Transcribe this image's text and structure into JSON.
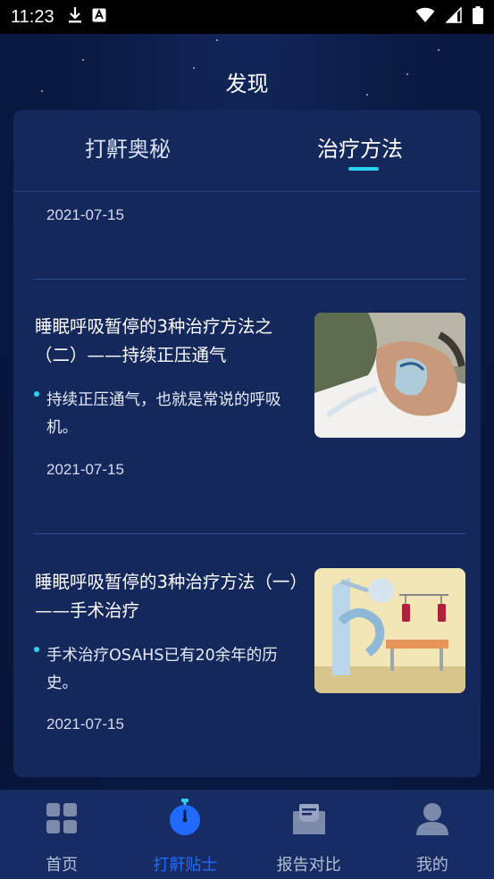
{
  "status_bar": {
    "time": "11:23"
  },
  "page": {
    "title": "发现"
  },
  "tabs": [
    {
      "label": "打鼾奥秘",
      "active": false
    },
    {
      "label": "治疗方法",
      "active": true
    }
  ],
  "articles": [
    {
      "date": "2021-07-15"
    },
    {
      "title": "睡眠呼吸暂停的3种治疗方法之（二）——持续正压通气",
      "desc": "持续正压通气，也就是常说的呼吸机。",
      "date": "2021-07-15"
    },
    {
      "title": "睡眠呼吸暂停的3种治疗方法（一）——手术治疗",
      "desc": "手术治疗OSAHS已有20余年的历史。",
      "date": "2021-07-15"
    }
  ],
  "bottom_nav": [
    {
      "label": "首页",
      "icon": "grid-icon",
      "active": false
    },
    {
      "label": "打鼾贴士",
      "icon": "stopwatch-icon",
      "active": true
    },
    {
      "label": "报告对比",
      "icon": "mail-report-icon",
      "active": false
    },
    {
      "label": "我的",
      "icon": "user-icon",
      "active": false
    }
  ],
  "colors": {
    "accent": "#29d3f0",
    "nav_active": "#1f6bff",
    "card": "#14285c",
    "background": "#0a1a44"
  }
}
